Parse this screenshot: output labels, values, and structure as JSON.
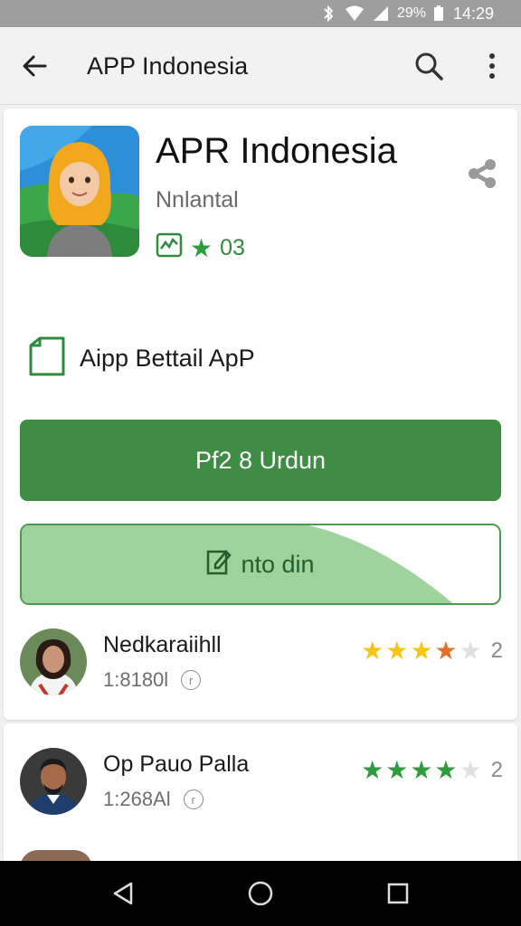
{
  "status_bar": {
    "battery": "29%",
    "time": "14:29"
  },
  "app_bar": {
    "title": "APP Indonesia"
  },
  "app": {
    "name": "APR Indonesia",
    "subtitle": "Nnlantal",
    "rating": "03"
  },
  "detail": {
    "label": "Aipp Bettail ApP"
  },
  "buttons": {
    "primary_label": "Pf2 8 Urdun",
    "secondary_label": "nto din"
  },
  "reviews": [
    {
      "name": "Nedkaraiihll",
      "time": "1:8180l",
      "rating": 4,
      "count": "2",
      "star_color": "#f5c518"
    },
    {
      "name": "Op Pauo Palla",
      "time": "1:268Al",
      "rating": 4,
      "count": "2",
      "star_color": "#2e9e3c"
    }
  ],
  "colors": {
    "primary_green": "#3f8c45",
    "light_green": "#9ed39e",
    "status_bar": "#9e9e9e"
  }
}
